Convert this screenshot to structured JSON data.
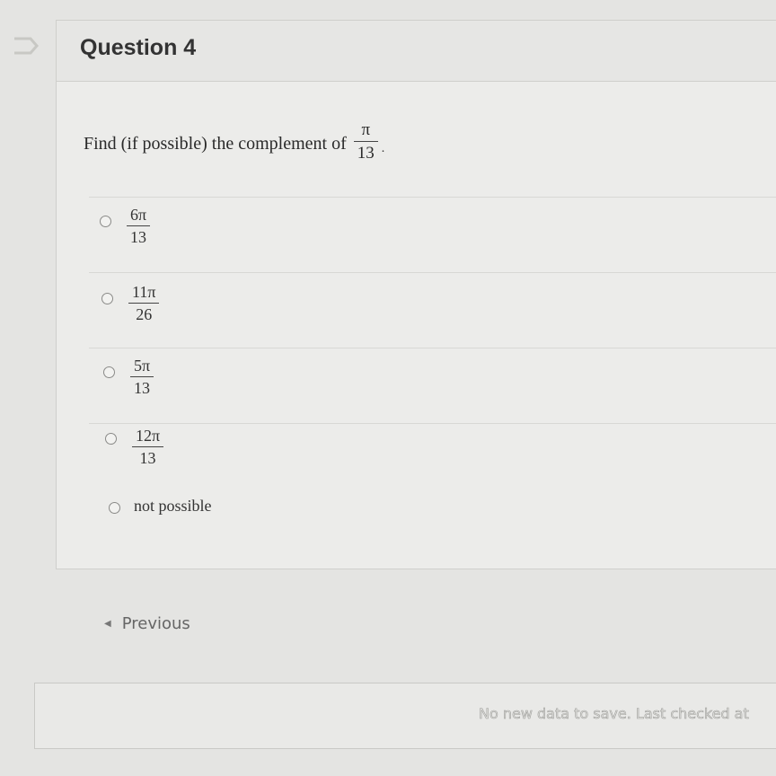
{
  "question": {
    "title": "Question 4",
    "prompt": "Find (if possible) the complement of",
    "prompt_fraction": {
      "num": "π",
      "den": "13"
    },
    "prompt_end": "."
  },
  "options": [
    {
      "num": "6π",
      "den": "13"
    },
    {
      "num": "11π",
      "den": "26"
    },
    {
      "num": "5π",
      "den": "13"
    },
    {
      "num": "12π",
      "den": "13"
    },
    {
      "text": "not possible"
    }
  ],
  "navigation": {
    "previous_label": "Previous"
  },
  "status": {
    "save_text": "No new data to save. Last checked at"
  }
}
